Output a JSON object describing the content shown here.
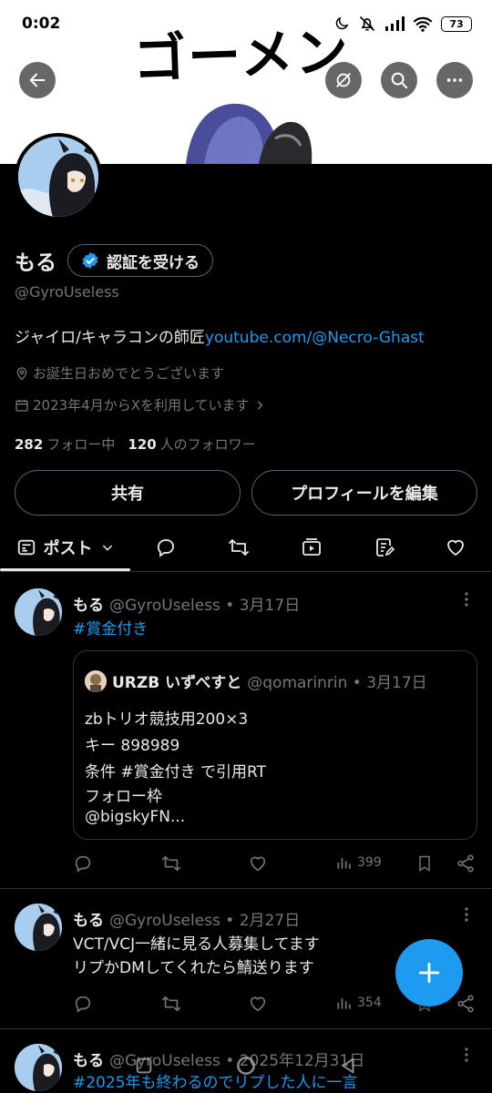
{
  "status_bar": {
    "time": "0:02",
    "battery": "73"
  },
  "banner": {
    "text": "ゴーメン"
  },
  "profile": {
    "display_name": "もる",
    "verify_button": "認証を受ける",
    "handle": "@GyroUseless",
    "bio_text": "ジャイロ/キャラコンの師匠",
    "bio_link": "youtube.com/@Necro-Ghast",
    "birthday": "お誕生日おめでとうございます",
    "joined": "2023年4月からXを利用しています",
    "following_count": "282",
    "following_label": "フォロー中",
    "followers_count": "120",
    "followers_label": "人のフォロワー"
  },
  "buttons": {
    "share": "共有",
    "edit_profile": "プロフィールを編集"
  },
  "tabs": {
    "posts_label": "ポスト"
  },
  "posts": [
    {
      "name": "もる",
      "meta": "@GyroUseless • 3月17日",
      "text": "#賞金付き",
      "quote": {
        "name": "URZB いずべすと",
        "meta": "@qomarinrin • 3月17日",
        "lines": [
          "zbトリオ競技用200×3",
          "キー 898989",
          "条件 #賞金付き で引用RT",
          "フォロー枠",
          "@bigskyFN..."
        ]
      },
      "views": "399"
    },
    {
      "name": "もる",
      "meta": "@GyroUseless • 2月27日",
      "lines": [
        "VCT/VCJ一緒に見る人募集してます",
        "リプかDMしてくれたら鯖送ります"
      ],
      "views": "354"
    },
    {
      "name": "もる",
      "meta": "@GyroUseless • 2025年12月31日",
      "text": "#2025年も終わるのでリプした人に一言"
    }
  ],
  "colors": {
    "accent": "#1d9bf0",
    "background": "#000000",
    "secondary_text": "#71767b"
  }
}
